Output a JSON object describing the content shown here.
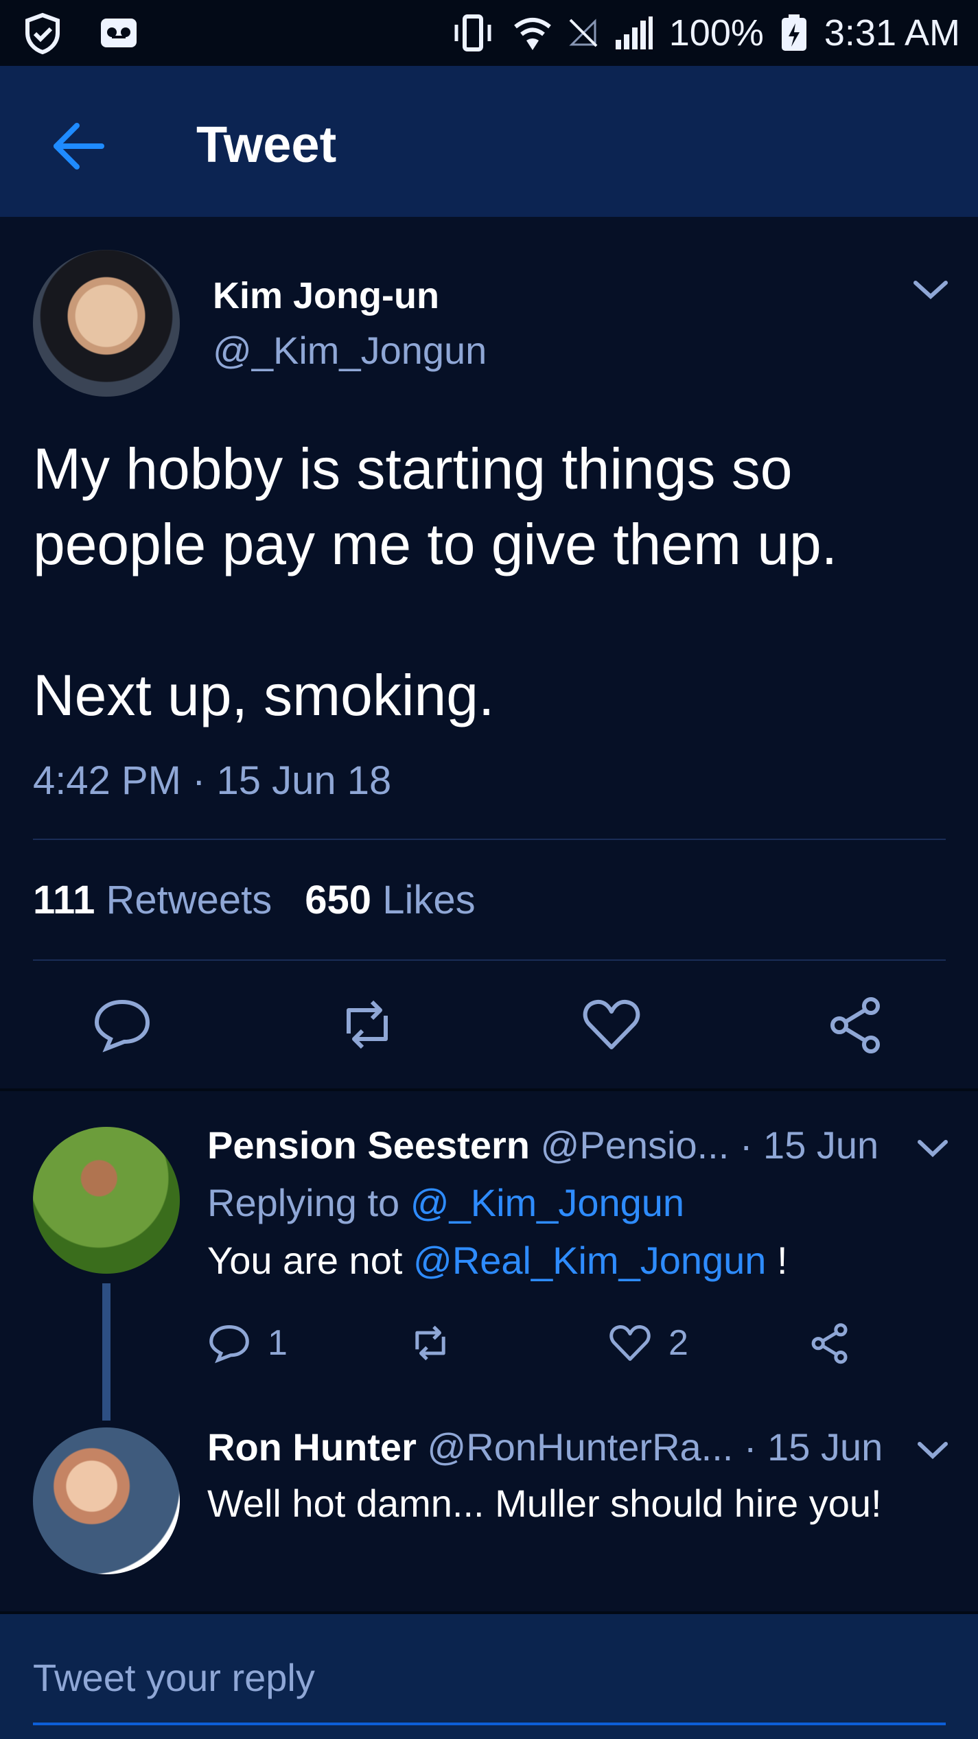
{
  "status_bar": {
    "battery": "100%",
    "time": "3:31 AM",
    "icons": [
      "shield-check-icon",
      "voicemail-icon",
      "vibrate-icon",
      "wifi-icon",
      "no-signal-icon",
      "signal-icon",
      "battery-charging-icon"
    ]
  },
  "header": {
    "title": "Tweet",
    "back_icon": "back-arrow-icon"
  },
  "tweet": {
    "author_name": "Kim Jong-un",
    "handle": "@_Kim_Jongun",
    "text": "My hobby is starting things so people pay me to give them up.\n\nNext up, smoking.",
    "timestamp": "4:42 PM · 15 Jun 18",
    "retweets_count": "111",
    "retweets_label": "Retweets",
    "likes_count": "650",
    "likes_label": "Likes"
  },
  "replies": [
    {
      "name": "Pension Seestern",
      "handle": "@Pensio...",
      "date": "· 15 Jun",
      "replying_to_label": "Replying to",
      "replying_to": "@_Kim_Jongun",
      "text_prefix": "You are not",
      "mention": "@Real_Kim_Jongun",
      "text_suffix": " !",
      "reply_count": "1",
      "like_count": "2"
    },
    {
      "name": "Ron Hunter",
      "handle": "@RonHunterRa...",
      "date": "· 15 Jun",
      "text": "Well hot damn... Muller should hire you!"
    }
  ],
  "composer": {
    "placeholder": "Tweet your reply"
  },
  "colors": {
    "background": "#061026",
    "appbar": "#0c2452",
    "accent": "#2e8cff",
    "muted": "#8fa7d6"
  }
}
